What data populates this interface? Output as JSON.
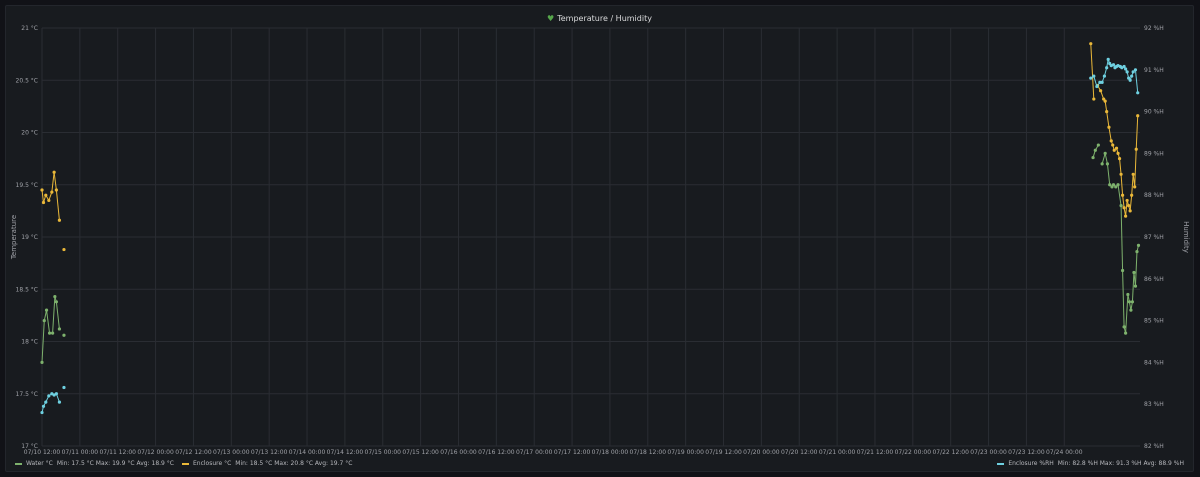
{
  "panel": {
    "title": "Temperature / Humidity"
  },
  "chart_data": {
    "type": "scatter",
    "title": "Temperature / Humidity",
    "ylabel_left": "Temperature",
    "ylabel_right": "Humidity",
    "x_range": [
      "07/10 12:00",
      "07/24 09:30"
    ],
    "ylim_left": [
      17,
      21
    ],
    "ylim_right": [
      82,
      92
    ],
    "yticks_left": [
      "17 °C",
      "17.5 °C",
      "18 °C",
      "18.5 °C",
      "19 °C",
      "19.5 °C",
      "20 °C",
      "20.5 °C",
      "21 °C"
    ],
    "yticks_right": [
      "82 %H",
      "83 %H",
      "84 %H",
      "85 %H",
      "86 %H",
      "87 %H",
      "88 %H",
      "89 %H",
      "90 %H",
      "91 %H",
      "92 %H"
    ],
    "xticks": [
      "07/10 12:00",
      "07/11 00:00",
      "07/11 12:00",
      "07/12 00:00",
      "07/12 12:00",
      "07/13 00:00",
      "07/13 12:00",
      "07/14 00:00",
      "07/14 12:00",
      "07/15 00:00",
      "07/15 12:00",
      "07/16 00:00",
      "07/16 12:00",
      "07/17 00:00",
      "07/17 12:00",
      "07/18 00:00",
      "07/18 12:00",
      "07/19 00:00",
      "07/19 12:00",
      "07/20 00:00",
      "07/20 12:00",
      "07/21 00:00",
      "07/21 12:00",
      "07/22 00:00",
      "07/22 12:00",
      "07/23 00:00",
      "07/23 12:00",
      "07/24 00:00"
    ],
    "grid": true,
    "legend_position": "bottom",
    "series": [
      {
        "name": "Water °C",
        "axis": "left",
        "color": "#7eb26d",
        "legend_stats": "Min: 17.5 °C  Max: 19.9 °C  Avg: 18.9 °C",
        "points": [
          [
            0.0,
            17.8
          ],
          [
            0.03,
            18.2
          ],
          [
            0.06,
            18.3
          ],
          [
            0.1,
            18.08
          ],
          [
            0.14,
            18.08
          ],
          [
            0.17,
            18.43
          ],
          [
            0.19,
            18.38
          ],
          [
            0.23,
            18.12
          ],
          [
            0.29,
            18.06
          ],
          [
            13.88,
            19.76
          ],
          [
            13.91,
            19.83
          ],
          [
            13.95,
            19.88
          ],
          [
            14.0,
            19.7
          ],
          [
            14.04,
            19.8
          ],
          [
            14.07,
            19.7
          ],
          [
            14.1,
            19.5
          ],
          [
            14.13,
            19.48
          ],
          [
            14.15,
            19.5
          ],
          [
            14.18,
            19.48
          ],
          [
            14.21,
            19.5
          ],
          [
            14.25,
            19.3
          ],
          [
            14.27,
            18.68
          ],
          [
            14.29,
            18.14
          ],
          [
            14.31,
            18.08
          ],
          [
            14.34,
            18.45
          ],
          [
            14.36,
            18.38
          ],
          [
            14.38,
            18.3
          ],
          [
            14.4,
            18.38
          ],
          [
            14.42,
            18.66
          ],
          [
            14.44,
            18.53
          ],
          [
            14.46,
            18.86
          ],
          [
            14.48,
            18.92
          ]
        ]
      },
      {
        "name": "Enclosure °C",
        "axis": "left",
        "color": "#eab839",
        "legend_stats": "Min: 18.5 °C  Max: 20.8 °C  Avg: 19.7 °C",
        "points": [
          [
            0.0,
            19.45
          ],
          [
            0.02,
            19.33
          ],
          [
            0.05,
            19.4
          ],
          [
            0.09,
            19.35
          ],
          [
            0.13,
            19.43
          ],
          [
            0.16,
            19.62
          ],
          [
            0.19,
            19.45
          ],
          [
            0.23,
            19.16
          ],
          [
            0.29,
            18.88
          ],
          [
            13.85,
            20.85
          ],
          [
            13.89,
            20.32
          ],
          [
            13.94,
            20.45
          ],
          [
            13.98,
            20.4
          ],
          [
            14.02,
            20.32
          ],
          [
            14.04,
            20.3
          ],
          [
            14.06,
            20.2
          ],
          [
            14.09,
            20.05
          ],
          [
            14.12,
            19.92
          ],
          [
            14.14,
            19.88
          ],
          [
            14.16,
            19.83
          ],
          [
            14.19,
            19.85
          ],
          [
            14.21,
            19.8
          ],
          [
            14.23,
            19.75
          ],
          [
            14.25,
            19.6
          ],
          [
            14.27,
            19.4
          ],
          [
            14.29,
            19.28
          ],
          [
            14.31,
            19.2
          ],
          [
            14.33,
            19.35
          ],
          [
            14.35,
            19.3
          ],
          [
            14.37,
            19.25
          ],
          [
            14.39,
            19.4
          ],
          [
            14.41,
            19.6
          ],
          [
            14.43,
            19.48
          ],
          [
            14.45,
            19.84
          ],
          [
            14.47,
            20.16
          ]
        ]
      },
      {
        "name": "Enclosure %RH",
        "axis": "right",
        "color": "#6ed0e0",
        "legend_stats": "Min: 82.8 %H  Max: 91.3 %H  Avg: 88.9 %H",
        "points": [
          [
            0.0,
            82.8
          ],
          [
            0.02,
            82.95
          ],
          [
            0.05,
            83.05
          ],
          [
            0.09,
            83.2
          ],
          [
            0.13,
            83.25
          ],
          [
            0.16,
            83.22
          ],
          [
            0.19,
            83.25
          ],
          [
            0.23,
            83.05
          ],
          [
            0.29,
            83.4
          ],
          [
            13.85,
            90.8
          ],
          [
            13.89,
            90.85
          ],
          [
            13.93,
            90.6
          ],
          [
            13.97,
            90.7
          ],
          [
            14.0,
            90.7
          ],
          [
            14.03,
            90.85
          ],
          [
            14.06,
            91.05
          ],
          [
            14.08,
            91.25
          ],
          [
            14.1,
            91.15
          ],
          [
            14.12,
            91.1
          ],
          [
            14.15,
            91.12
          ],
          [
            14.17,
            91.05
          ],
          [
            14.19,
            91.08
          ],
          [
            14.21,
            91.1
          ],
          [
            14.24,
            91.08
          ],
          [
            14.26,
            91.05
          ],
          [
            14.29,
            91.08
          ],
          [
            14.31,
            91.02
          ],
          [
            14.33,
            90.95
          ],
          [
            14.35,
            90.8
          ],
          [
            14.37,
            90.75
          ],
          [
            14.39,
            90.85
          ],
          [
            14.41,
            90.95
          ],
          [
            14.44,
            91.0
          ],
          [
            14.47,
            90.45
          ]
        ]
      }
    ]
  }
}
